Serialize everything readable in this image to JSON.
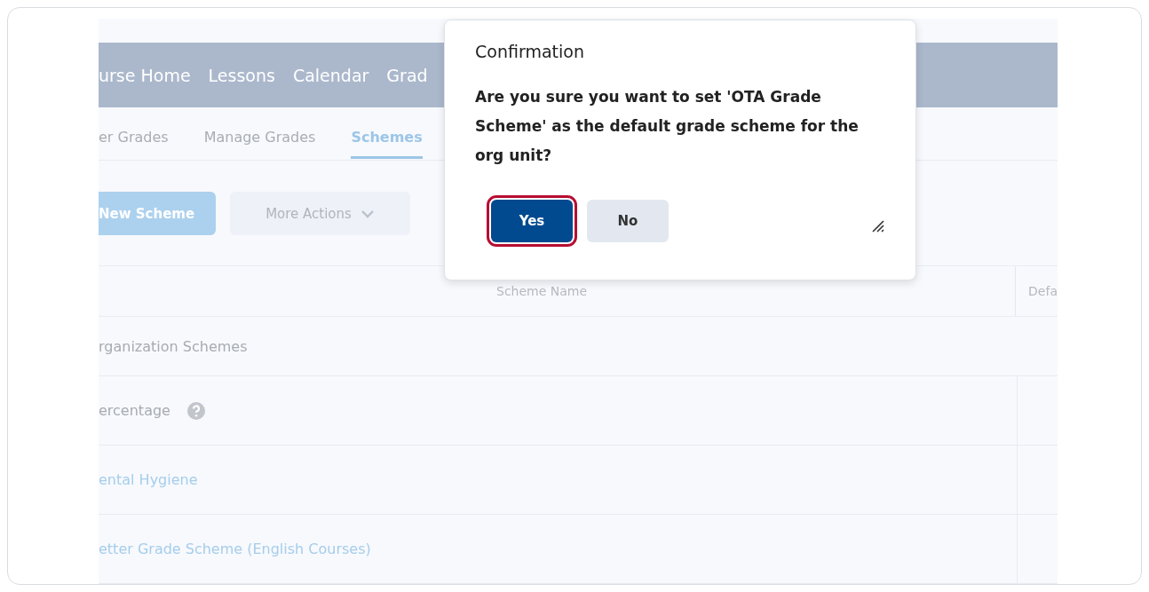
{
  "navbar": {
    "items": [
      "urse Home",
      "Lessons",
      "Calendar",
      "Grad"
    ]
  },
  "tabs": [
    {
      "label": "er Grades",
      "selected": false
    },
    {
      "label": "Manage Grades",
      "selected": false
    },
    {
      "label": "Schemes",
      "selected": true
    }
  ],
  "toolbar": {
    "primary_button": "New Scheme",
    "menu_button": "More Actions"
  },
  "table": {
    "columns": [
      "Scheme Name",
      "Defa"
    ],
    "rows": [
      {
        "kind": "group",
        "name": "rganization Schemes",
        "help": false
      },
      {
        "kind": "plain",
        "name": "ercentage",
        "help": true
      },
      {
        "kind": "link",
        "name": "ental Hygiene",
        "help": false
      },
      {
        "kind": "link",
        "name": "etter Grade Scheme (English Courses)",
        "help": false
      }
    ]
  },
  "dialog": {
    "title": "Confirmation",
    "message": "Are you sure you want to set 'OTA Grade Scheme' as the default grade scheme for the org unit?",
    "buttons": [
      {
        "label": "Yes",
        "primary": true,
        "focused": true
      },
      {
        "label": "No",
        "primary": false,
        "focused": false
      }
    ]
  }
}
